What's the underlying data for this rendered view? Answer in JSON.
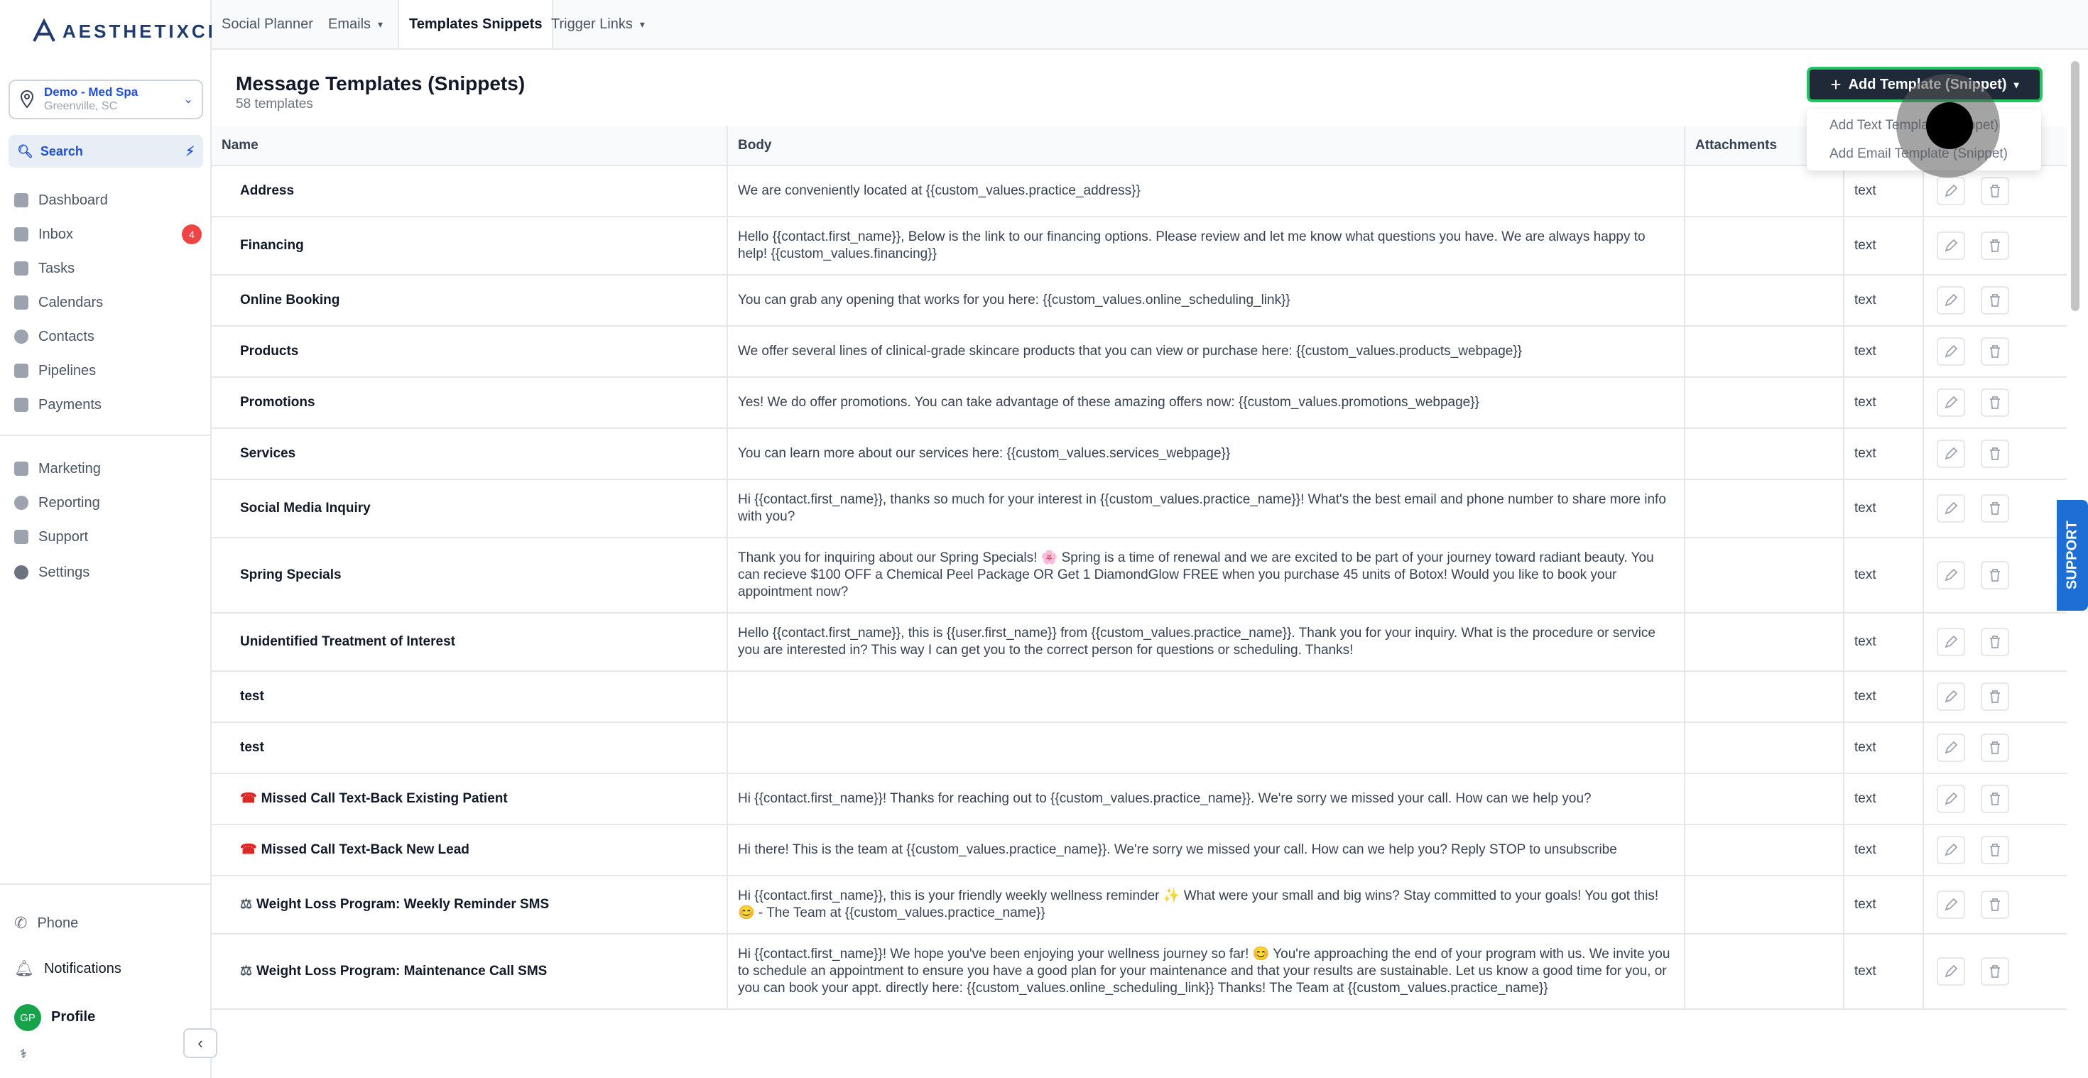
{
  "brand": {
    "logo_text": "AESTHETIXCRM"
  },
  "location": {
    "name": "Demo - Med Spa",
    "city": "Greenville, SC"
  },
  "search": {
    "label": "Search"
  },
  "sidebar": {
    "items": [
      {
        "label": "Dashboard"
      },
      {
        "label": "Inbox",
        "badge": "4"
      },
      {
        "label": "Tasks"
      },
      {
        "label": "Calendars"
      },
      {
        "label": "Contacts"
      },
      {
        "label": "Pipelines"
      },
      {
        "label": "Payments"
      },
      {
        "label": "Marketing"
      },
      {
        "label": "Reporting"
      },
      {
        "label": "Support"
      },
      {
        "label": "Settings"
      }
    ],
    "bottom": {
      "phone": "Phone",
      "notifications": "Notifications",
      "profile": "Profile",
      "avatar_initials": "GP"
    }
  },
  "topnav": {
    "tabs": [
      {
        "label": "Social Planner"
      },
      {
        "label": "Emails"
      },
      {
        "label": "Templates Snippets"
      },
      {
        "label": "Trigger Links"
      }
    ]
  },
  "header": {
    "title": "Message Templates (Snippets)",
    "subtitle": "58 templates"
  },
  "add_button": {
    "label": "Add Template (Snippet)",
    "options": [
      "Add Text Template (Snippet)",
      "Add Email Template (Snippet)"
    ]
  },
  "table": {
    "columns": [
      "Name",
      "Body",
      "Attachments",
      "",
      ""
    ],
    "rows": [
      {
        "name": "Address",
        "body": "We are conveniently located at {{custom_values.practice_address}}",
        "type": "text"
      },
      {
        "name": "Financing",
        "body": "Hello {{contact.first_name}}, Below is the link to our financing options. Please review and let me know what questions you have. We are always happy to help! {{custom_values.financing}}",
        "type": "text"
      },
      {
        "name": "Online Booking",
        "body": "You can grab any opening that works for you here: {{custom_values.online_scheduling_link}}",
        "type": "text"
      },
      {
        "name": "Products",
        "body": "We offer several lines of clinical-grade skincare products that you can view or purchase here: {{custom_values.products_webpage}}",
        "type": "text"
      },
      {
        "name": "Promotions",
        "body": "Yes! We do offer promotions. You can take advantage of these amazing offers now: {{custom_values.promotions_webpage}}",
        "type": "text"
      },
      {
        "name": "Services",
        "body": "You can learn more about our services here: {{custom_values.services_webpage}}",
        "type": "text"
      },
      {
        "name": "Social Media Inquiry",
        "body": "Hi {{contact.first_name}}, thanks so much for your interest in {{custom_values.practice_name}}! What's the best email and phone number to share more info with you?",
        "type": "text"
      },
      {
        "name": "Spring Specials",
        "body": "Thank you for inquiring about our Spring Specials! 🌸 Spring is a time of renewal and we are excited to be part of your journey toward radiant beauty. You can recieve $100 OFF a Chemical Peel Package OR Get 1 DiamondGlow FREE when you purchase 45 units of Botox! Would you like to book your appointment now?",
        "type": "text"
      },
      {
        "name": "Unidentified Treatment of Interest",
        "body": "Hello {{contact.first_name}}, this is {{user.first_name}} from {{custom_values.practice_name}}. Thank you for your inquiry. What is the procedure or service you are interested in? This way I can get you to the correct person for questions or scheduling. Thanks!",
        "type": "text"
      },
      {
        "name": "test",
        "body": "",
        "type": "text"
      },
      {
        "name": "test",
        "body": "",
        "type": "text"
      },
      {
        "name": "Missed Call Text-Back Existing Patient",
        "icon": "☎",
        "body": "Hi {{contact.first_name}}! Thanks for reaching out to {{custom_values.practice_name}}. We're sorry we missed your call. How can we help you?",
        "type": "text"
      },
      {
        "name": "Missed Call Text-Back New Lead",
        "icon": "☎",
        "body": "Hi there! This is the team at {{custom_values.practice_name}}. We're sorry we missed your call. How can we help you? Reply STOP to unsubscribe",
        "type": "text"
      },
      {
        "name": "Weight Loss Program: Weekly Reminder SMS",
        "icon": "⚖",
        "body": "Hi {{contact.first_name}}, this is your friendly weekly wellness reminder ✨ What were your small and big wins? Stay committed to your goals! You got this! 😊 - The Team at {{custom_values.practice_name}}",
        "type": "text"
      },
      {
        "name": "Weight Loss Program: Maintenance Call SMS",
        "icon": "⚖",
        "body": "Hi {{contact.first_name}}! We hope you've been enjoying your wellness journey so far! 😊 You're approaching the end of your program with us. We invite you to schedule an appointment to ensure you have a good plan for your maintenance and that your results are sustainable. Let us know a good time for you, or you can book your appt. directly here: {{custom_values.online_scheduling_link}} Thanks! The Team at {{custom_values.practice_name}}",
        "type": "text"
      }
    ]
  },
  "support_tab": {
    "label": "SUPPORT"
  },
  "colors": {
    "accent": "#1d4ed8",
    "button_bg": "#1f2937",
    "focus_ring": "#22c55e",
    "badge": "#ef4444",
    "support": "#1d6fd6"
  }
}
